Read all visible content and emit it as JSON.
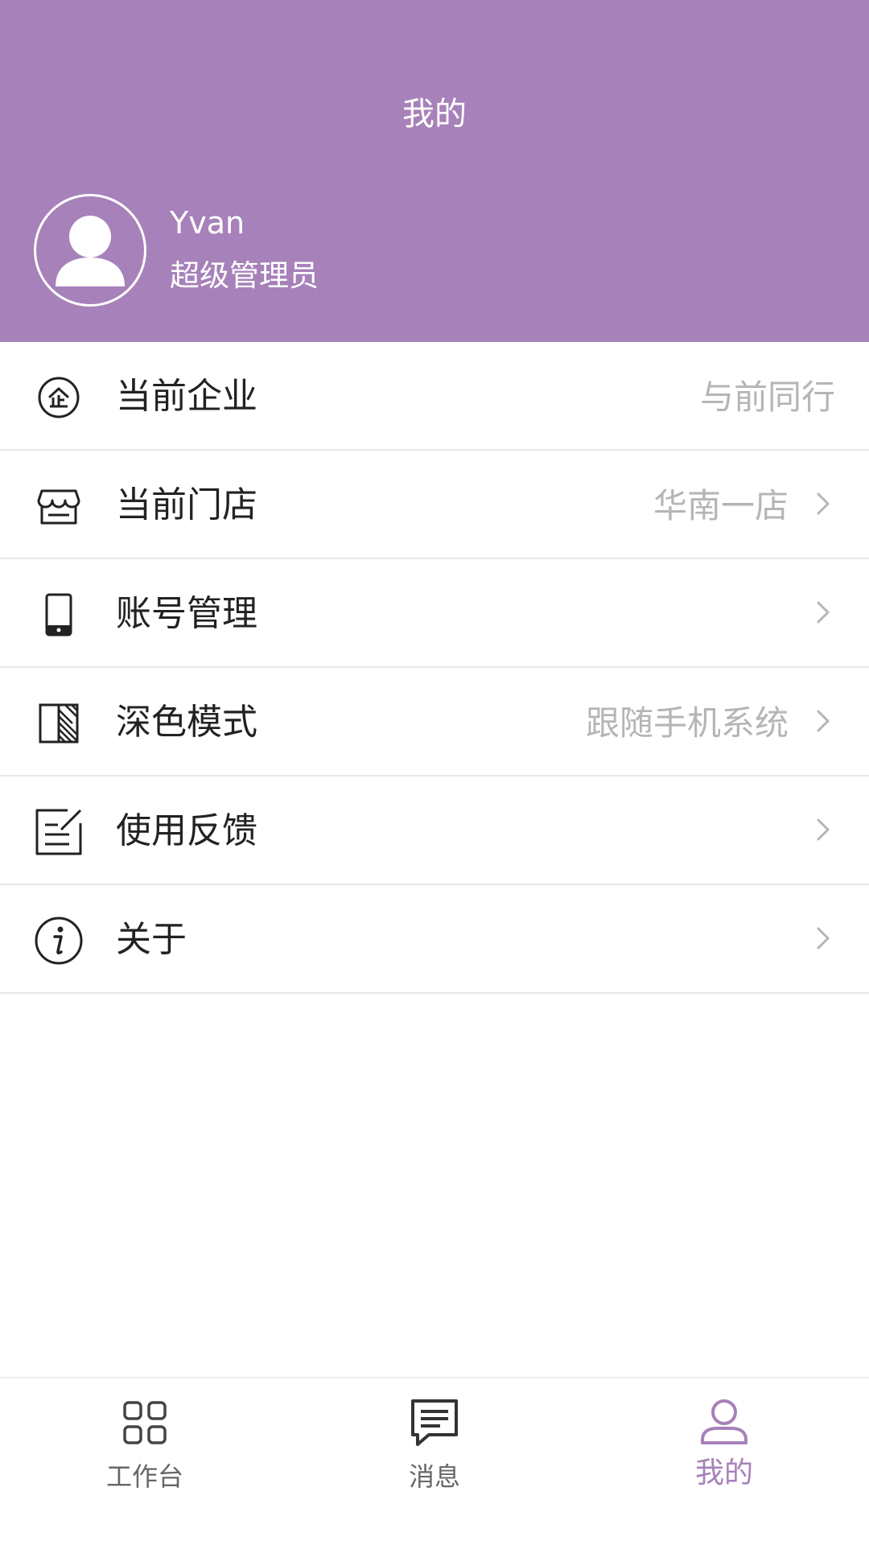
{
  "header": {
    "title": "我的",
    "user_name": "Yvan",
    "user_role": "超级管理员",
    "background_color": "#a781b9"
  },
  "menu": {
    "items": [
      {
        "label": "当前企业",
        "value": "与前同行",
        "icon": "enterprise-icon",
        "has_arrow": false
      },
      {
        "label": "当前门店",
        "value": "华南一店",
        "icon": "store-icon",
        "has_arrow": true
      },
      {
        "label": "账号管理",
        "value": "",
        "icon": "phone-icon",
        "has_arrow": true
      },
      {
        "label": "深色模式",
        "value": "跟随手机系统",
        "icon": "dark-mode-icon",
        "has_arrow": true
      },
      {
        "label": "使用反馈",
        "value": "",
        "icon": "feedback-icon",
        "has_arrow": true
      },
      {
        "label": "关于",
        "value": "",
        "icon": "info-icon",
        "has_arrow": true
      }
    ]
  },
  "tabbar": {
    "tabs": [
      {
        "label": "工作台",
        "icon": "grid-icon",
        "active": false
      },
      {
        "label": "消息",
        "icon": "message-icon",
        "active": false
      },
      {
        "label": "我的",
        "icon": "user-icon",
        "active": true
      }
    ],
    "active_color": "#a781b9",
    "inactive_color": "#666666"
  }
}
